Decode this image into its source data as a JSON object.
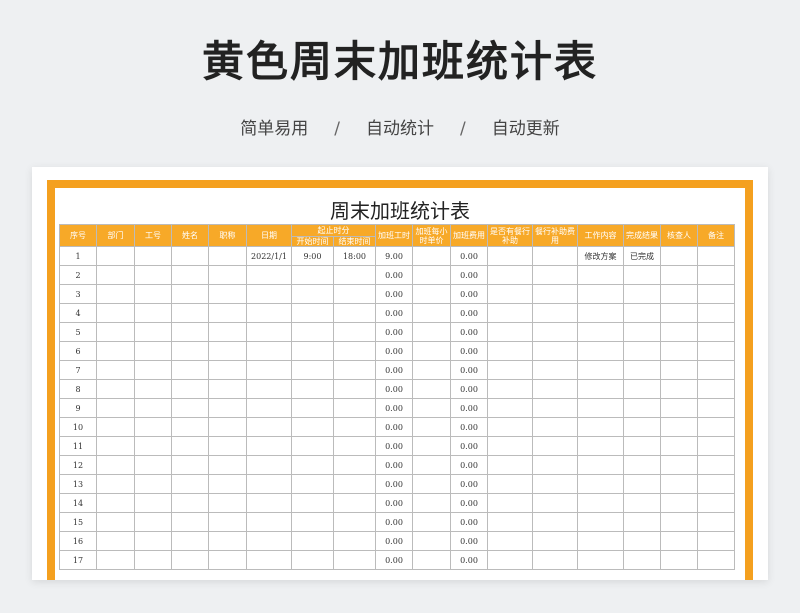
{
  "header": {
    "title": "黄色周末加班统计表",
    "tags": [
      "简单易用",
      "自动统计",
      "自动更新"
    ],
    "separator": "/"
  },
  "sheet": {
    "title": "周末加班统计表",
    "columns": {
      "seq": "序号",
      "dept": "部门",
      "emp_id": "工号",
      "name": "姓名",
      "position": "职称",
      "date": "日期",
      "time_range": "起止时分",
      "start_time": "开始时间",
      "end_time": "结束时间",
      "ot_hours": "加班工时",
      "hourly_rate": "加班每小时单价",
      "ot_fee": "加班费用",
      "has_allowance": "是否有餐行补助",
      "meal_allowance": "餐行补助费用",
      "work_content": "工作内容",
      "result": "完成结果",
      "reviewer": "核查人",
      "remark": "备注"
    },
    "rows": [
      {
        "seq": "1",
        "dept": "",
        "emp_id": "",
        "name": "",
        "position": "",
        "date": "2022/1/1",
        "start": "9:00",
        "end": "18:00",
        "ot_hours": "9.00",
        "rate": "",
        "fee": "0.00",
        "has_allowance": "",
        "meal": "",
        "content": "修改方案",
        "result": "已完成",
        "reviewer": "",
        "remark": ""
      },
      {
        "seq": "2",
        "dept": "",
        "emp_id": "",
        "name": "",
        "position": "",
        "date": "",
        "start": "",
        "end": "",
        "ot_hours": "0.00",
        "rate": "",
        "fee": "0.00",
        "has_allowance": "",
        "meal": "",
        "content": "",
        "result": "",
        "reviewer": "",
        "remark": ""
      },
      {
        "seq": "3",
        "dept": "",
        "emp_id": "",
        "name": "",
        "position": "",
        "date": "",
        "start": "",
        "end": "",
        "ot_hours": "0.00",
        "rate": "",
        "fee": "0.00",
        "has_allowance": "",
        "meal": "",
        "content": "",
        "result": "",
        "reviewer": "",
        "remark": ""
      },
      {
        "seq": "4",
        "dept": "",
        "emp_id": "",
        "name": "",
        "position": "",
        "date": "",
        "start": "",
        "end": "",
        "ot_hours": "0.00",
        "rate": "",
        "fee": "0.00",
        "has_allowance": "",
        "meal": "",
        "content": "",
        "result": "",
        "reviewer": "",
        "remark": ""
      },
      {
        "seq": "5",
        "dept": "",
        "emp_id": "",
        "name": "",
        "position": "",
        "date": "",
        "start": "",
        "end": "",
        "ot_hours": "0.00",
        "rate": "",
        "fee": "0.00",
        "has_allowance": "",
        "meal": "",
        "content": "",
        "result": "",
        "reviewer": "",
        "remark": ""
      },
      {
        "seq": "6",
        "dept": "",
        "emp_id": "",
        "name": "",
        "position": "",
        "date": "",
        "start": "",
        "end": "",
        "ot_hours": "0.00",
        "rate": "",
        "fee": "0.00",
        "has_allowance": "",
        "meal": "",
        "content": "",
        "result": "",
        "reviewer": "",
        "remark": ""
      },
      {
        "seq": "7",
        "dept": "",
        "emp_id": "",
        "name": "",
        "position": "",
        "date": "",
        "start": "",
        "end": "",
        "ot_hours": "0.00",
        "rate": "",
        "fee": "0.00",
        "has_allowance": "",
        "meal": "",
        "content": "",
        "result": "",
        "reviewer": "",
        "remark": ""
      },
      {
        "seq": "8",
        "dept": "",
        "emp_id": "",
        "name": "",
        "position": "",
        "date": "",
        "start": "",
        "end": "",
        "ot_hours": "0.00",
        "rate": "",
        "fee": "0.00",
        "has_allowance": "",
        "meal": "",
        "content": "",
        "result": "",
        "reviewer": "",
        "remark": ""
      },
      {
        "seq": "9",
        "dept": "",
        "emp_id": "",
        "name": "",
        "position": "",
        "date": "",
        "start": "",
        "end": "",
        "ot_hours": "0.00",
        "rate": "",
        "fee": "0.00",
        "has_allowance": "",
        "meal": "",
        "content": "",
        "result": "",
        "reviewer": "",
        "remark": ""
      },
      {
        "seq": "10",
        "dept": "",
        "emp_id": "",
        "name": "",
        "position": "",
        "date": "",
        "start": "",
        "end": "",
        "ot_hours": "0.00",
        "rate": "",
        "fee": "0.00",
        "has_allowance": "",
        "meal": "",
        "content": "",
        "result": "",
        "reviewer": "",
        "remark": ""
      },
      {
        "seq": "11",
        "dept": "",
        "emp_id": "",
        "name": "",
        "position": "",
        "date": "",
        "start": "",
        "end": "",
        "ot_hours": "0.00",
        "rate": "",
        "fee": "0.00",
        "has_allowance": "",
        "meal": "",
        "content": "",
        "result": "",
        "reviewer": "",
        "remark": ""
      },
      {
        "seq": "12",
        "dept": "",
        "emp_id": "",
        "name": "",
        "position": "",
        "date": "",
        "start": "",
        "end": "",
        "ot_hours": "0.00",
        "rate": "",
        "fee": "0.00",
        "has_allowance": "",
        "meal": "",
        "content": "",
        "result": "",
        "reviewer": "",
        "remark": ""
      },
      {
        "seq": "13",
        "dept": "",
        "emp_id": "",
        "name": "",
        "position": "",
        "date": "",
        "start": "",
        "end": "",
        "ot_hours": "0.00",
        "rate": "",
        "fee": "0.00",
        "has_allowance": "",
        "meal": "",
        "content": "",
        "result": "",
        "reviewer": "",
        "remark": ""
      },
      {
        "seq": "14",
        "dept": "",
        "emp_id": "",
        "name": "",
        "position": "",
        "date": "",
        "start": "",
        "end": "",
        "ot_hours": "0.00",
        "rate": "",
        "fee": "0.00",
        "has_allowance": "",
        "meal": "",
        "content": "",
        "result": "",
        "reviewer": "",
        "remark": ""
      },
      {
        "seq": "15",
        "dept": "",
        "emp_id": "",
        "name": "",
        "position": "",
        "date": "",
        "start": "",
        "end": "",
        "ot_hours": "0.00",
        "rate": "",
        "fee": "0.00",
        "has_allowance": "",
        "meal": "",
        "content": "",
        "result": "",
        "reviewer": "",
        "remark": ""
      },
      {
        "seq": "16",
        "dept": "",
        "emp_id": "",
        "name": "",
        "position": "",
        "date": "",
        "start": "",
        "end": "",
        "ot_hours": "0.00",
        "rate": "",
        "fee": "0.00",
        "has_allowance": "",
        "meal": "",
        "content": "",
        "result": "",
        "reviewer": "",
        "remark": ""
      },
      {
        "seq": "17",
        "dept": "",
        "emp_id": "",
        "name": "",
        "position": "",
        "date": "",
        "start": "",
        "end": "",
        "ot_hours": "0.00",
        "rate": "",
        "fee": "0.00",
        "has_allowance": "",
        "meal": "",
        "content": "",
        "result": "",
        "reviewer": "",
        "remark": ""
      }
    ]
  },
  "colors": {
    "accent": "#f4a01f",
    "header_fill": "#f7a928",
    "background": "#eef0f2"
  }
}
